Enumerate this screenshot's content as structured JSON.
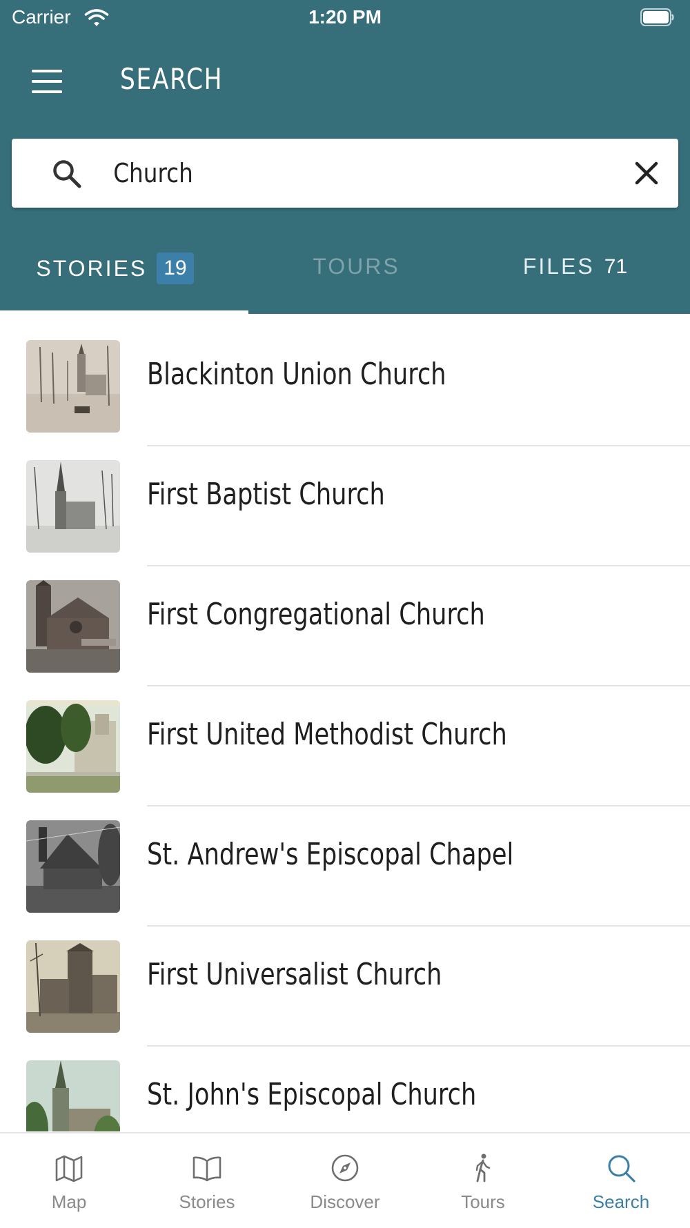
{
  "status_bar": {
    "carrier": "Carrier",
    "time": "1:20 PM"
  },
  "header": {
    "title": "SEARCH"
  },
  "search": {
    "value": "Church"
  },
  "tabs": [
    {
      "label": "STORIES",
      "count": "19",
      "selected": true
    },
    {
      "label": "TOURS",
      "count": "",
      "selected": false
    },
    {
      "label": "FILES",
      "count": "71",
      "selected": false
    }
  ],
  "results": [
    {
      "title": "Blackinton Union Church"
    },
    {
      "title": "First Baptist Church"
    },
    {
      "title": "First Congregational Church"
    },
    {
      "title": "First United Methodist Church"
    },
    {
      "title": "St. Andrew's Episcopal Chapel"
    },
    {
      "title": "First Universalist Church"
    },
    {
      "title": "St. John's Episcopal Church"
    }
  ],
  "bottom_nav": {
    "items": [
      {
        "label": "Map",
        "icon": "map-icon"
      },
      {
        "label": "Stories",
        "icon": "book-icon"
      },
      {
        "label": "Discover",
        "icon": "compass-icon"
      },
      {
        "label": "Tours",
        "icon": "walking-person-icon"
      },
      {
        "label": "Search",
        "icon": "search-icon"
      }
    ],
    "active": "Search"
  },
  "colors": {
    "header_bg": "#366e7a",
    "badge_bg": "#3c7fa8",
    "active_nav": "#3b7fa8",
    "inactive_nav": "#8a8a8a"
  }
}
